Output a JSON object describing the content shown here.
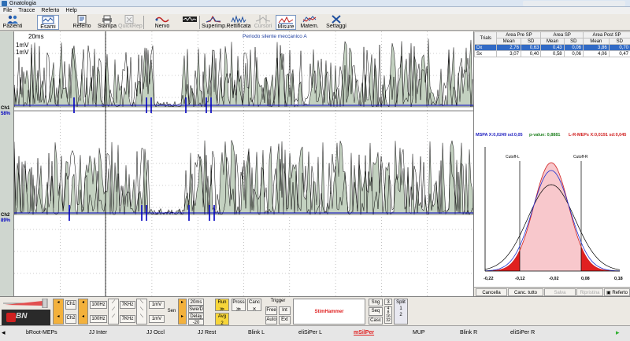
{
  "window": {
    "title": "Gnatologia"
  },
  "menu": [
    "File",
    "Tracce",
    "Referto",
    "Help"
  ],
  "toolbar": [
    {
      "label": "Pazienti",
      "icon": "patients-icon",
      "enabled": true
    },
    {
      "label": "Esami",
      "icon": "exams-icon",
      "enabled": true,
      "pressed": true
    },
    {
      "label": "Referto",
      "icon": "report-icon",
      "enabled": true
    },
    {
      "label": "Stampa",
      "icon": "print-icon",
      "enabled": true
    },
    {
      "label": "QuickRep",
      "icon": "quickrep-icon",
      "enabled": false
    },
    {
      "label": "Nervo",
      "icon": "nerve-icon",
      "enabled": true
    },
    {
      "label": "Superimp.",
      "icon": "superimpose-icon",
      "enabled": true
    },
    {
      "label": "Rettificata",
      "icon": "rectified-icon",
      "enabled": true
    },
    {
      "label": "Cursori",
      "icon": "cursors-icon",
      "enabled": false
    },
    {
      "label": "Misure",
      "icon": "measures-icon",
      "enabled": true,
      "pressed": true
    },
    {
      "label": "Matem.",
      "icon": "math-icon",
      "enabled": true
    },
    {
      "label": "Settaggi",
      "icon": "settings-icon",
      "enabled": true
    }
  ],
  "plot": {
    "time_scale": "20ms",
    "amp_top": "1mV",
    "amp_bottom": "1mV",
    "title": "Periodo silente meccanico A",
    "channels": [
      {
        "label": "Ch1",
        "pct": "58%"
      },
      {
        "label": "Ch2",
        "pct": "89%"
      }
    ]
  },
  "table": {
    "group_headers": [
      "Trials",
      "Area Pre SP",
      "Area SP",
      "Area Post SP"
    ],
    "sub_headers": [
      "Mean",
      "SD",
      "Mean",
      "SD",
      "Mean",
      "SD"
    ],
    "rows": [
      {
        "name": "Dx",
        "values": [
          "2,76",
          "0,63",
          "0,43",
          "0,06",
          "3,86",
          "0,70"
        ],
        "selected": true
      },
      {
        "name": "Sx",
        "values": [
          "3,07",
          "0,40",
          "0,58",
          "0,06",
          "4,06",
          "0,47"
        ],
        "selected": false
      }
    ]
  },
  "stats": {
    "mspa": "MSPA X:0,0249 sd:0,05",
    "pvalue": "p-value: 0,8881",
    "lrmeps": "L-R-MEPs X:0,0191 sd:0,045"
  },
  "distribution": {
    "cutoff_l": "Cutoff-L",
    "cutoff_r": "Cutoff-R",
    "x_ticks": [
      "-0,22",
      "-0,12",
      "-0,02",
      "0,08",
      "0,18"
    ]
  },
  "panel_buttons": [
    {
      "label": "Cancella",
      "enabled": true
    },
    {
      "label": "Canc. tutto",
      "enabled": true
    },
    {
      "label": "Salva",
      "enabled": false
    },
    {
      "label": "Ripristina",
      "enabled": false
    },
    {
      "label": "Referto",
      "enabled": true
    }
  ],
  "controls": {
    "ch1": "Ch1",
    "ch2": "Ch2",
    "hp1": "100Hz",
    "hp2": "100Hz",
    "lp1": "7KHz",
    "lp2": "7KHz",
    "sens1": "1mV",
    "sens2": "1mV",
    "sen_label": "Sen",
    "sweep": "20ms",
    "swe_d": "Swe/D",
    "delay_label": "Delay",
    "delay": "-20",
    "run": "Run",
    "avg": "Avg",
    "avg_value": "2",
    "pross": "Pross",
    "canc": "Canc",
    "trigger_title": "Trigger",
    "free": "Free",
    "int": "Int",
    "auto": "Auto",
    "ext": "Ext",
    "stim": "StimHammer",
    "sng": "Sng",
    "seq": "Seq",
    "casc": "Casc",
    "split": "Split",
    "split_values": [
      "1",
      "2",
      "4",
      "8",
      "16",
      "32"
    ],
    "seq_value": "3"
  },
  "tabs": [
    {
      "label": "bRoot-MEPs",
      "active": false
    },
    {
      "label": "JJ Inter",
      "active": false
    },
    {
      "label": "JJ Occl",
      "active": false
    },
    {
      "label": "JJ Rest",
      "active": false
    },
    {
      "label": "Blink L",
      "active": false
    },
    {
      "label": "eliSiPer L",
      "active": false
    },
    {
      "label": "mSilPer",
      "active": true
    },
    {
      "label": "MUP",
      "active": false
    },
    {
      "label": "Blink R",
      "active": false
    },
    {
      "label": "eliSiPer R",
      "active": false
    }
  ],
  "colors": {
    "waveform_fill": "#c3d1c0",
    "baseline": "#0000c0",
    "curve_red": "#d02020",
    "curve_blue": "#2030d0",
    "tail_fill": "#f8c8cc"
  }
}
